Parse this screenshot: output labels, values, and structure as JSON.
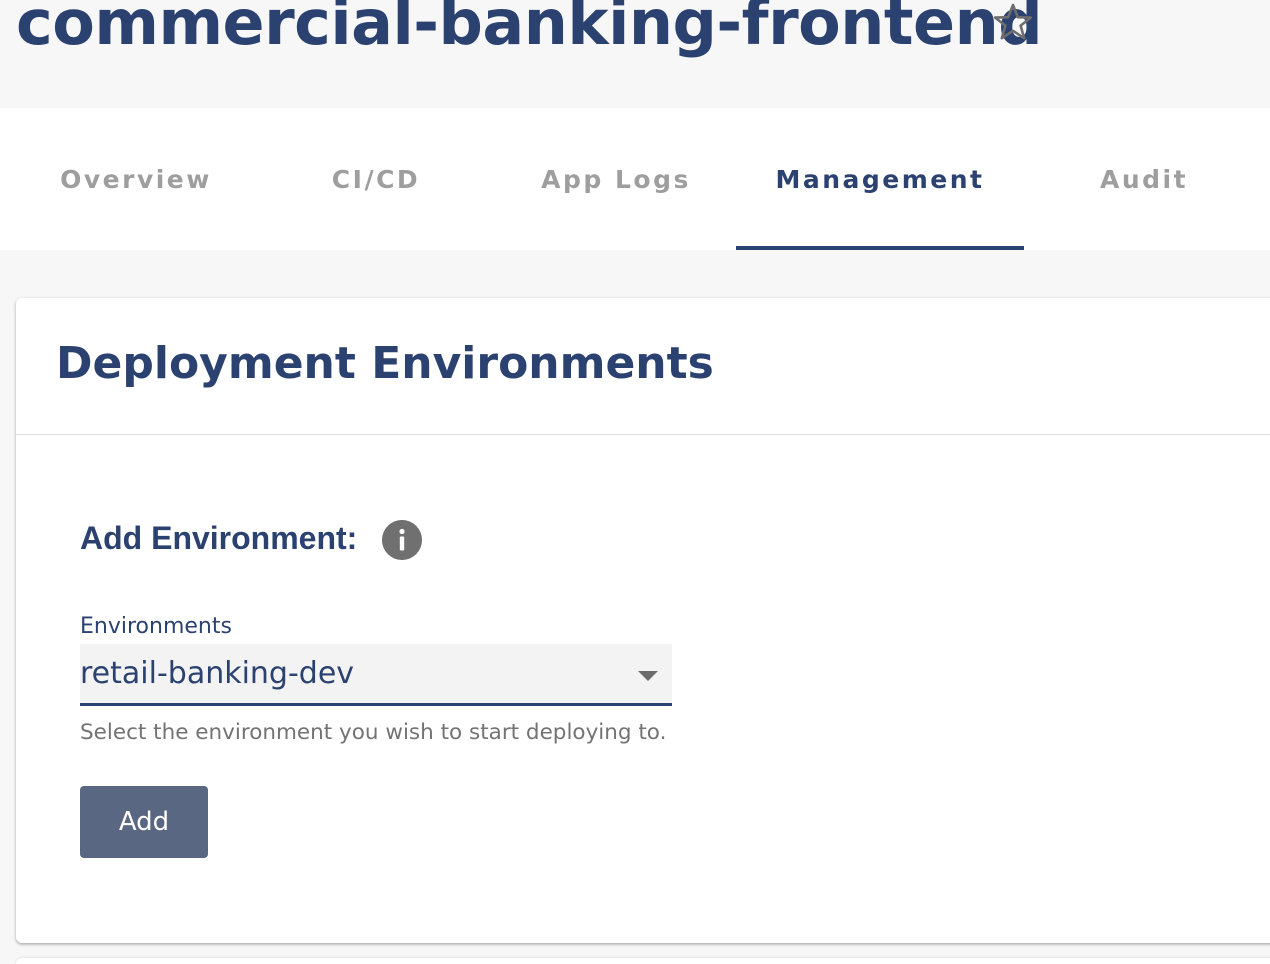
{
  "header": {
    "title": "commercial-banking-frontend",
    "favorite_icon": "star-outline-icon"
  },
  "tabs": [
    {
      "label": "Overview",
      "active": false
    },
    {
      "label": "CI/CD",
      "active": false
    },
    {
      "label": "App Logs",
      "active": false
    },
    {
      "label": "Management",
      "active": true
    },
    {
      "label": "Audit",
      "active": false
    }
  ],
  "card": {
    "title": "Deployment Environments",
    "section_heading": "Add Environment:",
    "info_icon": "info-icon",
    "environments_field": {
      "label": "Environments",
      "selected_value": "retail-banking-dev",
      "helper_text": "Select the environment you wish to start deploying to."
    },
    "add_button_label": "Add"
  },
  "colors": {
    "primary": "#2b4270",
    "tab_inactive": "#9e9e9e",
    "button_bg": "#5a6783",
    "page_bg": "#f7f7f7",
    "info_icon_bg": "#707070"
  }
}
